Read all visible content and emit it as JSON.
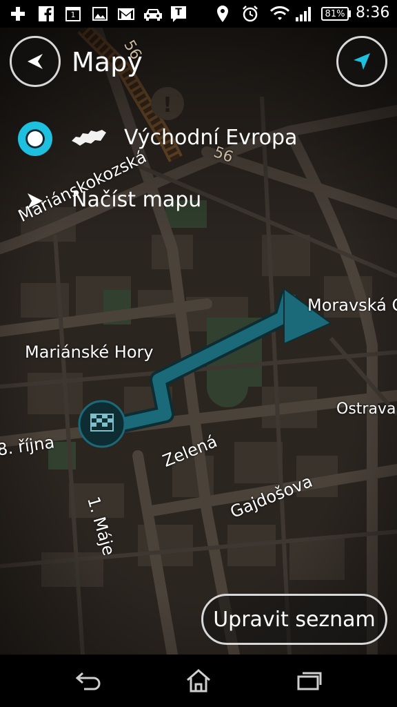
{
  "status_bar": {
    "battery": "81%",
    "time": "8:36",
    "icons": [
      "plus-icon",
      "facebook-icon",
      "calendar-icon",
      "gallery-icon",
      "gmail-icon",
      "car-icon",
      "tmobile-icon",
      "location-icon",
      "alarm-icon",
      "wifi-icon",
      "signal-icon",
      "battery-icon"
    ],
    "calendar_day": "1",
    "tmobile_letter": "T"
  },
  "header": {
    "title": "Mapy",
    "back_icon": "back-arrow-icon",
    "compass_icon": "navigation-arrow-icon"
  },
  "map_list": {
    "selected_item": {
      "label": "Východní Evropa",
      "icon": "region-map-icon",
      "selected": true
    },
    "load_item": {
      "label": "Načíst mapu",
      "icon": "chevron-right-icon"
    }
  },
  "map_labels": {
    "road_56_a": "56",
    "road_56_b": "56",
    "marianskokozska": "Mariánskokozská",
    "marianske_hory": "Mariánské Hory",
    "moravska": "Moravská O",
    "ostrava": "Ostrava",
    "rijna": "8. října",
    "zelena": "Zelená",
    "maje": "1. Máje",
    "gajdosova": "Gajdošova"
  },
  "actions": {
    "edit_list": "Upravit seznam"
  },
  "navigation_bar": {
    "icons": [
      "back-icon",
      "home-icon",
      "recent-apps-icon"
    ]
  },
  "colors": {
    "accent": "#1ec0e0",
    "route": "#1a6a7a",
    "background": "#2b2520"
  }
}
